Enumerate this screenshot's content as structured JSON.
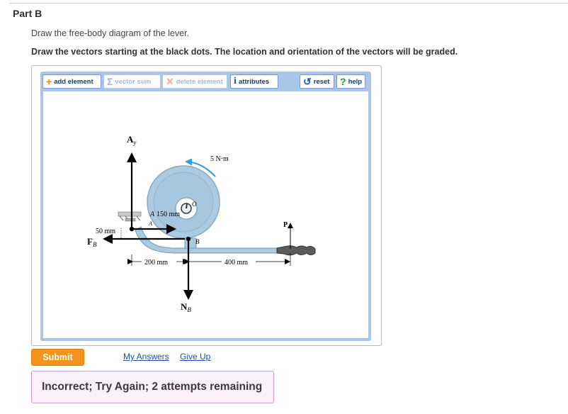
{
  "part": {
    "title": "Part B"
  },
  "instructions": {
    "line1": "Draw the free-body diagram of the lever.",
    "line2": "Draw the vectors starting at the black dots. The location and orientation of the vectors will be graded."
  },
  "toolbar": {
    "add_element": "add element",
    "vector_sum": "vector sum",
    "delete_element": "delete element",
    "attributes": "attributes",
    "reset": "reset",
    "help": "help"
  },
  "diagram": {
    "labels": {
      "ay": "A",
      "ay_sub": "y",
      "moment": "5 N·m",
      "o": "O",
      "a_top": "A",
      "a_bottom": "A",
      "dim_150": "150 mm",
      "dim_50": "50 mm",
      "fb": "F",
      "fb_sub": "B",
      "b": "B",
      "p": "P",
      "dim_200": "200 mm",
      "dim_400": "400 mm",
      "nb": "N",
      "nb_sub": "B"
    }
  },
  "actions": {
    "submit": "Submit",
    "my_answers": "My Answers",
    "give_up": "Give Up"
  },
  "feedback": {
    "message": "Incorrect; Try Again; 2 attempts remaining"
  }
}
